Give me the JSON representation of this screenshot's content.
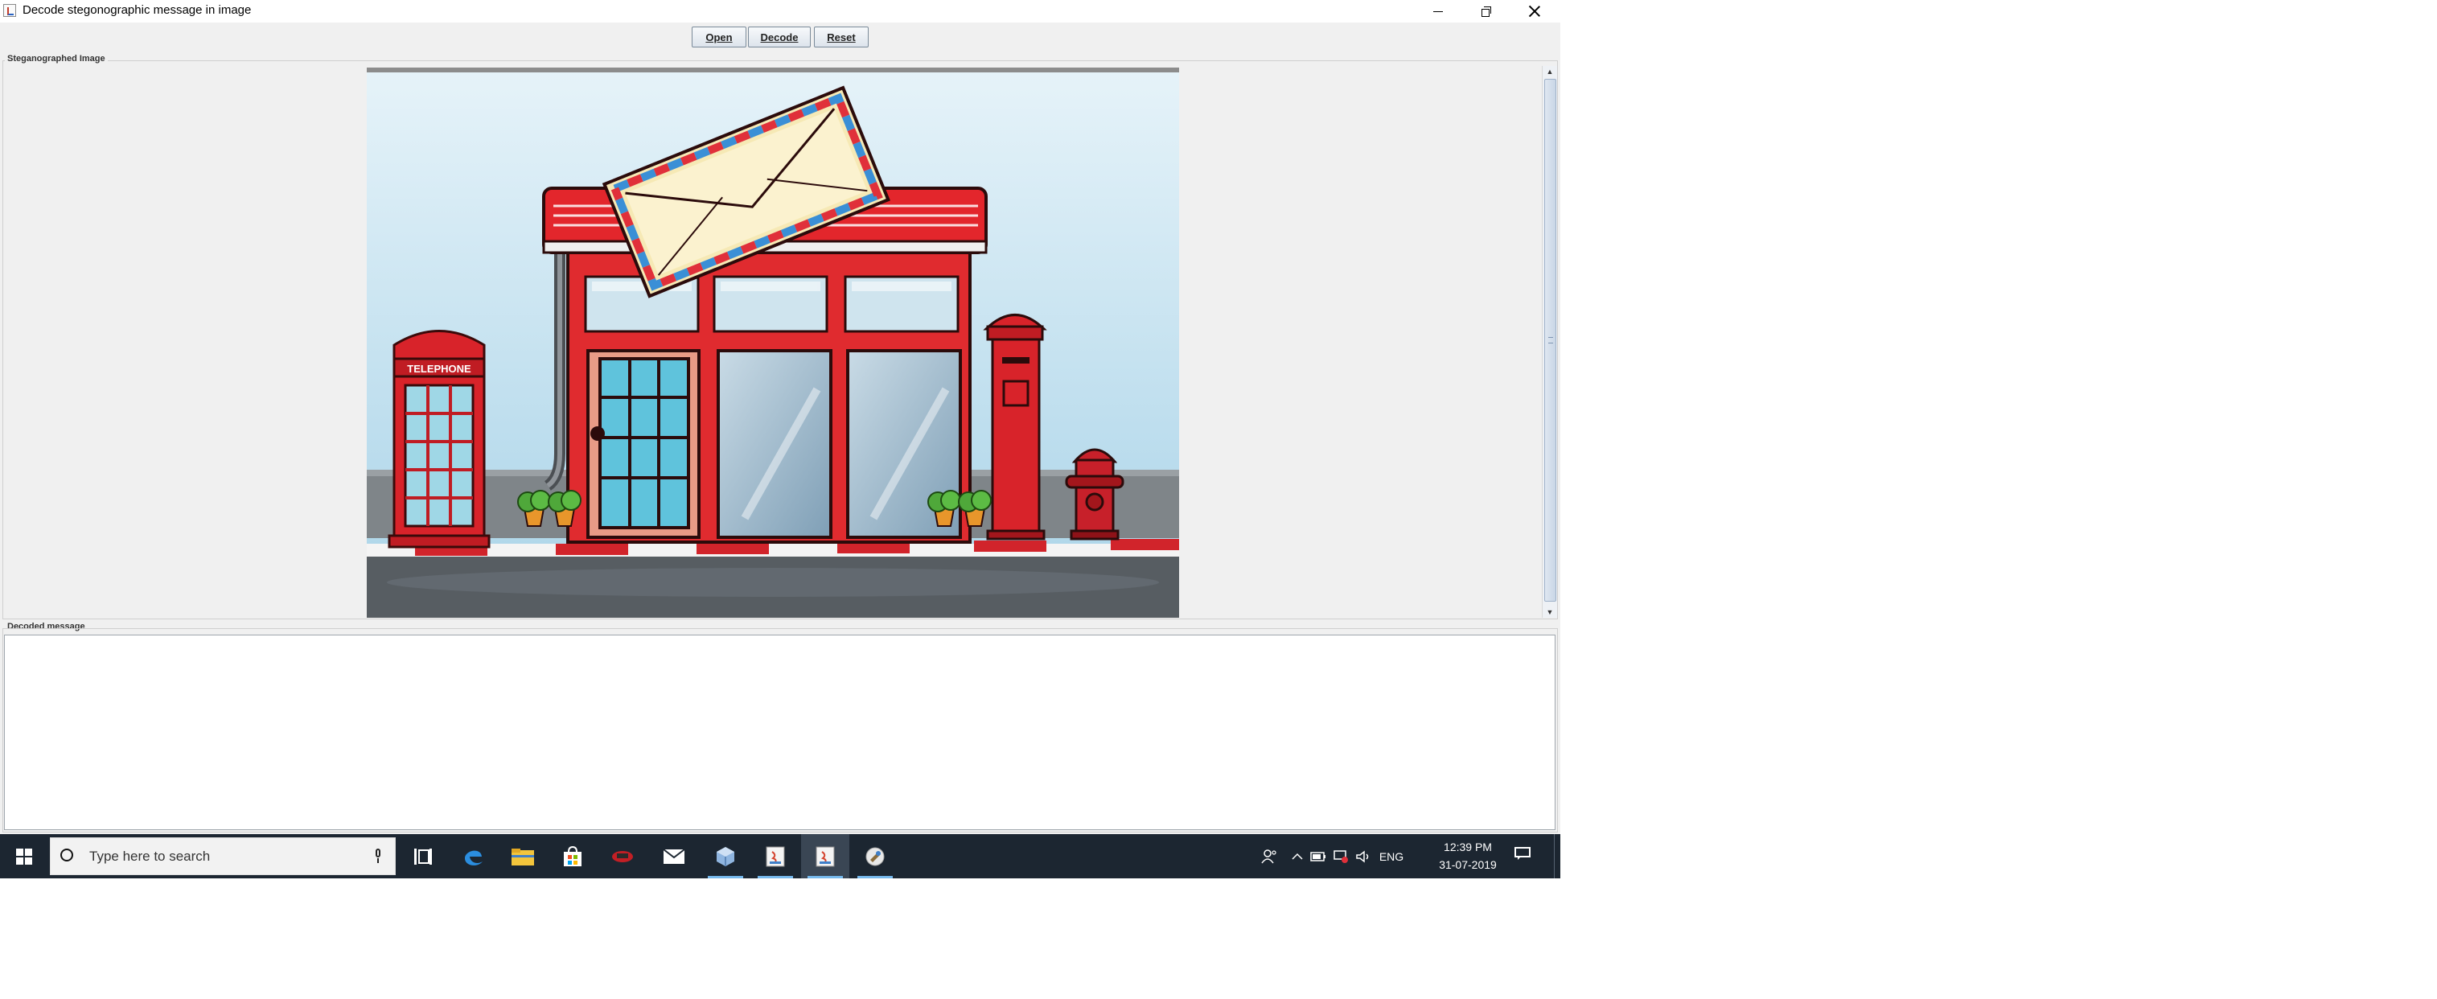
{
  "window": {
    "title": "Decode stegonographic message in image",
    "controls": {
      "minimize": "minimize-icon",
      "maximize": "maximize-icon",
      "close": "close-icon"
    }
  },
  "toolbar": {
    "open_label": "Open",
    "decode_label": "Decode",
    "reset_label": "Reset"
  },
  "image_panel": {
    "title": "Steganographed Image",
    "image_sign": "TELEPHONE"
  },
  "message_panel": {
    "title": "Decoded message",
    "value": ""
  },
  "taskbar": {
    "search_placeholder": "Type here to search",
    "apps": [
      "task-view-icon",
      "edge-icon",
      "file-explorer-icon",
      "store-icon",
      "red-app-icon",
      "mail-icon",
      "cube-app-icon",
      "java-app-icon",
      "java-app-icon",
      "decode-app-icon"
    ],
    "active_app_highlight": "#76b9ed",
    "tray": {
      "language": "ENG",
      "time": "12:39 PM",
      "date": "31-07-2019"
    }
  },
  "colors": {
    "window_bg": "#f0f0f0",
    "taskbar_bg": "#1c2631",
    "building_red": "#e02b2f"
  }
}
